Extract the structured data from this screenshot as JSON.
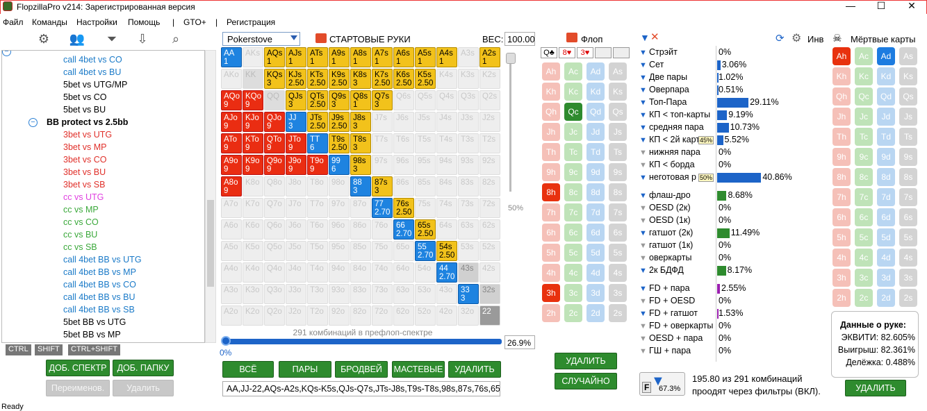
{
  "window": {
    "title": "FlopzillaPro v214: Зарегистрированная версия",
    "min": "—",
    "max": "☐",
    "close": "✕"
  },
  "menu": [
    "Файл",
    "Команды",
    "Настройки",
    "Помощь",
    "|",
    "GTO+",
    "|",
    "Регистрация"
  ],
  "toolbar_icons": [
    "gear-icon",
    "users-icon",
    "filter-icon",
    "import-icon",
    "search-icon"
  ],
  "tree": {
    "items": [
      {
        "label": "call 4bet vs CO",
        "color": "#1a7ac8",
        "indent": 1
      },
      {
        "label": "call 4bet vs BU",
        "color": "#1a7ac8",
        "indent": 1
      },
      {
        "label": "5bet vs UTG/MP",
        "color": "#000",
        "indent": 1
      },
      {
        "label": "5bet vs CO",
        "color": "#000",
        "indent": 1
      },
      {
        "label": "5bet vs BU",
        "color": "#000",
        "indent": 1
      },
      {
        "label": "BB protect vs 2.5bb",
        "color": "#000",
        "indent": 0,
        "bold": true,
        "toggle": "−"
      },
      {
        "label": "3bet vs UTG",
        "color": "#e0302a",
        "indent": 1
      },
      {
        "label": "3bet vs MP",
        "color": "#e0302a",
        "indent": 1
      },
      {
        "label": "3bet vs CO",
        "color": "#e0302a",
        "indent": 1
      },
      {
        "label": "3bet vs BU",
        "color": "#e0302a",
        "indent": 1
      },
      {
        "label": "3bet vs SB",
        "color": "#e0302a",
        "indent": 1
      },
      {
        "label": "cc vs UTG",
        "color": "#e040e0",
        "indent": 1
      },
      {
        "label": "cc vs MP",
        "color": "#3aa83a",
        "indent": 1
      },
      {
        "label": "cc vs CO",
        "color": "#3aa83a",
        "indent": 1
      },
      {
        "label": "cc vs BU",
        "color": "#3aa83a",
        "indent": 1
      },
      {
        "label": "cc vs SB",
        "color": "#3aa83a",
        "indent": 1
      },
      {
        "label": "call 4bet BB vs UTG",
        "color": "#1a7ac8",
        "indent": 1
      },
      {
        "label": "call 4bet BB vs MP",
        "color": "#1a7ac8",
        "indent": 1
      },
      {
        "label": "call 4bet BB vs CO",
        "color": "#1a7ac8",
        "indent": 1
      },
      {
        "label": "call 4bet BB vs BU",
        "color": "#1a7ac8",
        "indent": 1
      },
      {
        "label": "call 4bet BB vs SB",
        "color": "#1a7ac8",
        "indent": 1
      },
      {
        "label": "5bet BB vs UTG",
        "color": "#000",
        "indent": 1
      },
      {
        "label": "5bet BB vs MP",
        "color": "#000",
        "indent": 1
      }
    ]
  },
  "keys": [
    "CTRL",
    "SHIFT",
    "CTRL+SHIFT"
  ],
  "left_buttons": {
    "add_spectrum": "ДОБ. СПЕКТР",
    "add_folder": "ДОБ. ПАПКУ",
    "rename": "Переименов.",
    "delete": "Удалить"
  },
  "range": {
    "source": "Pokerstove",
    "title": "СТАРТОВЫЕ РУКИ",
    "weight_label": "ВЕС:",
    "weight": "100.00",
    "slider_pct": "50%",
    "combos_text": "291 комбинаций в префлоп-спектре",
    "progress_left": "0%",
    "progress_right": "26.9%",
    "text": "AA,JJ-22,AQs-A2s,KQs-K5s,QJs-Q7s,JTs-J8s,T9s-T8s,98s,87s,76s,65"
  },
  "range_buttons": [
    "ВСЁ",
    "ПАРЫ",
    "БРОДВЕЙ",
    "МАСТЕВЫЕ",
    "УДАЛИТЬ"
  ],
  "ranks": [
    "A",
    "K",
    "Q",
    "J",
    "T",
    "9",
    "8",
    "7",
    "6",
    "5",
    "4",
    "3",
    "2"
  ],
  "cells": {
    "0,0": [
      "b",
      "1"
    ],
    "0,2": [
      "y",
      "1"
    ],
    "0,3": [
      "y",
      "1"
    ],
    "0,4": [
      "y",
      "1"
    ],
    "0,5": [
      "y",
      "1"
    ],
    "0,6": [
      "y",
      "1"
    ],
    "0,7": [
      "y",
      "1"
    ],
    "0,8": [
      "y",
      "1"
    ],
    "0,9": [
      "y",
      "1"
    ],
    "0,10": [
      "y",
      "1"
    ],
    "0,12": [
      "y",
      "1"
    ],
    "1,2": [
      "y",
      "3"
    ],
    "1,3": [
      "y",
      "2.50"
    ],
    "1,4": [
      "y",
      "2.50"
    ],
    "1,5": [
      "y",
      "2.50"
    ],
    "1,6": [
      "y",
      "3"
    ],
    "1,7": [
      "y",
      "2.50"
    ],
    "1,8": [
      "y",
      "2.50"
    ],
    "1,9": [
      "y",
      "2.50"
    ],
    "2,0": [
      "r",
      "9"
    ],
    "2,1": [
      "r",
      "9"
    ],
    "2,3": [
      "y",
      "3"
    ],
    "2,4": [
      "y",
      "2.50"
    ],
    "2,5": [
      "y",
      "3"
    ],
    "2,6": [
      "y",
      "1"
    ],
    "2,7": [
      "y",
      "3"
    ],
    "3,0": [
      "r",
      "9"
    ],
    "3,1": [
      "r",
      "9"
    ],
    "3,2": [
      "r",
      "9"
    ],
    "3,3": [
      "b",
      "3"
    ],
    "3,4": [
      "y",
      "2.50"
    ],
    "3,5": [
      "y",
      "2.50"
    ],
    "3,6": [
      "y",
      "3"
    ],
    "4,0": [
      "r",
      "9"
    ],
    "4,1": [
      "r",
      "9"
    ],
    "4,2": [
      "r",
      "9"
    ],
    "4,3": [
      "r",
      "9"
    ],
    "4,4": [
      "b",
      "6"
    ],
    "4,5": [
      "y",
      "2.50"
    ],
    "4,6": [
      "y",
      "3"
    ],
    "5,0": [
      "r",
      "9"
    ],
    "5,1": [
      "r",
      "9"
    ],
    "5,2": [
      "r",
      "9"
    ],
    "5,3": [
      "r",
      "9"
    ],
    "5,4": [
      "r",
      "9"
    ],
    "5,5": [
      "b",
      "6"
    ],
    "5,6": [
      "y",
      "3"
    ],
    "6,0": [
      "r",
      "9"
    ],
    "6,6": [
      "b",
      "3"
    ],
    "6,7": [
      "y",
      "3"
    ],
    "7,7": [
      "b",
      "2.70"
    ],
    "7,8": [
      "y",
      "2.50"
    ],
    "8,8": [
      "b",
      "2.70"
    ],
    "8,9": [
      "y",
      "2.50"
    ],
    "9,9": [
      "b",
      "2.70"
    ],
    "9,10": [
      "y",
      "2.50"
    ],
    "10,10": [
      "b",
      "2.70"
    ],
    "10,11": [
      "g",
      ""
    ],
    "11,11": [
      "b",
      "3"
    ],
    "11,12": [
      "g",
      ""
    ],
    "12,12": [
      "g2",
      ""
    ]
  },
  "flop": {
    "title": "Флоп",
    "slots": [
      "Q♣",
      "8♥",
      "3♥",
      "",
      ""
    ],
    "suits": [
      "h",
      "c",
      "d",
      "s"
    ],
    "selected": {
      "Qc": "green",
      "8h": "red",
      "3h": "red"
    },
    "buttons": {
      "delete": "УДАЛИТЬ",
      "random": "СЛУЧАЙНО"
    }
  },
  "stats": {
    "groups": [
      [
        [
          "Стрэйт",
          "0%",
          0,
          "#1d64c8"
        ],
        [
          "Сет",
          "3.06%",
          3.06,
          "#1d64c8"
        ],
        [
          "Две пары",
          "1.02%",
          1.02,
          "#1d64c8"
        ],
        [
          "Оверпара",
          "0.51%",
          0.51,
          "#1d64c8"
        ],
        [
          "Топ-Пара",
          "29.11%",
          29.11,
          "#1d64c8"
        ],
        [
          "КП < топ-карты",
          "9.19%",
          9.19,
          "#1d64c8"
        ],
        [
          "средняя пара",
          "10.73%",
          10.73,
          "#1d64c8"
        ],
        [
          "КП < 2й карт",
          "5.52%",
          5.52,
          "#1d64c8"
        ],
        [
          "нижняя пара",
          "0%",
          0,
          "#1d64c8"
        ],
        [
          "КП < борда",
          "0%",
          0,
          "#1d64c8"
        ],
        [
          "неготовая р",
          "40.86%",
          40.86,
          "#1d64c8"
        ]
      ],
      [
        [
          "флаш-дро",
          "8.68%",
          8.68,
          "#2e8b2e"
        ],
        [
          "OESD (2к)",
          "0%",
          0,
          "#2e8b2e"
        ],
        [
          "OESD (1к)",
          "0%",
          0,
          "#2e8b2e"
        ],
        [
          "гатшот (2к)",
          "11.49%",
          11.49,
          "#2e8b2e"
        ],
        [
          "гатшот (1к)",
          "0%",
          0,
          "#2e8b2e"
        ],
        [
          "оверкарты",
          "0%",
          0,
          "#2e8b2e"
        ],
        [
          "2к БДФД",
          "8.17%",
          8.17,
          "#2e8b2e"
        ]
      ],
      [
        [
          "FD + пара",
          "2.55%",
          2.55,
          "#9b1fb0"
        ],
        [
          "FD + OESD",
          "0%",
          0,
          "#9b1fb0"
        ],
        [
          "FD + гатшот",
          "1.53%",
          1.53,
          "#9b1fb0"
        ],
        [
          "FD + оверкарты",
          "0%",
          0,
          "#9b1fb0"
        ],
        [
          "OESD + пара",
          "0%",
          0,
          "#9b1fb0"
        ],
        [
          "ГШ + пара",
          "0%",
          0,
          "#9b1fb0"
        ]
      ]
    ],
    "tag_45": "45%",
    "tag_50": "50%",
    "inv": "Инв",
    "filter_pct": "67.3%",
    "summary1": "195.80 из 291 комбинаций",
    "summary2": "проодят через фильтры (ВКЛ)."
  },
  "dead": {
    "title": "Мёртвые карты",
    "selected": {
      "Ah": "red",
      "Ad": "blue"
    },
    "delete": "УДАЛИТЬ"
  },
  "info": {
    "title": "Данные о руке:",
    "equity": "ЭКВИТИ: 82.605%",
    "win": "Выигрыш: 82.361%",
    "tie": "Делёжка: 0.488%"
  },
  "status": "Ready"
}
